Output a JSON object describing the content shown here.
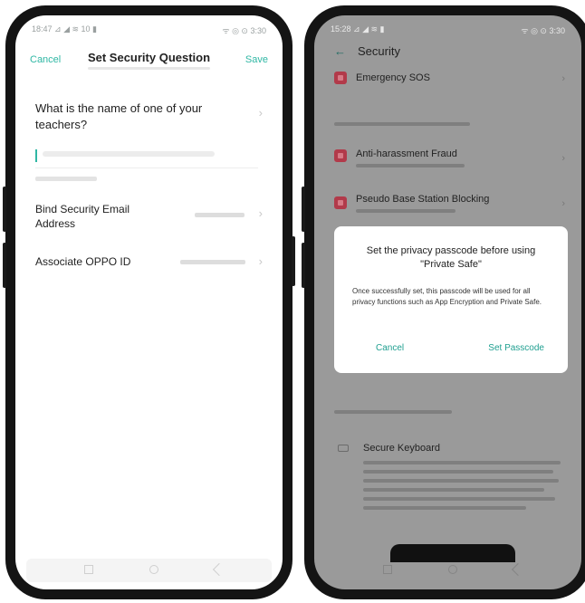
{
  "left_screen": {
    "status": {
      "left": "18:47 ⊿ ◢ ≋ 10 ▮",
      "right": "ᯤ ◎ ⊙ 3:30"
    },
    "header": {
      "cancel_label": "Cancel",
      "title": "Set Security Question",
      "save_label": "Save"
    },
    "question": "What is the name of one of your teachers?",
    "rows": [
      {
        "label": "Bind Security Email Address"
      },
      {
        "label": "Associate OPPO ID"
      }
    ]
  },
  "right_screen": {
    "status": {
      "left": "15:28 ⊿ ◢ ≋ ▮",
      "right": "ᯤ ◎ ⊙ 3:30"
    },
    "header": {
      "back_icon": "back-arrow-icon",
      "title": "Security"
    },
    "items": [
      {
        "label": "Emergency SOS"
      },
      {
        "label": "Anti-harassment Fraud"
      },
      {
        "label": "Pseudo Base Station Blocking"
      }
    ],
    "dialog": {
      "title": "Set the privacy passcode before using \"Private Safe\"",
      "body": "Once successfully set, this passcode will be used for all privacy functions such as App Encryption and Private Safe.",
      "cancel_label": "Cancel",
      "set_label": "Set Passcode"
    },
    "keyboard_item": {
      "icon": "keyboard-icon",
      "label": "Secure Keyboard"
    }
  },
  "colors": {
    "accent": "#2fb7a4",
    "item_icon": "#b23a4a",
    "phone_frame": "#141414"
  }
}
